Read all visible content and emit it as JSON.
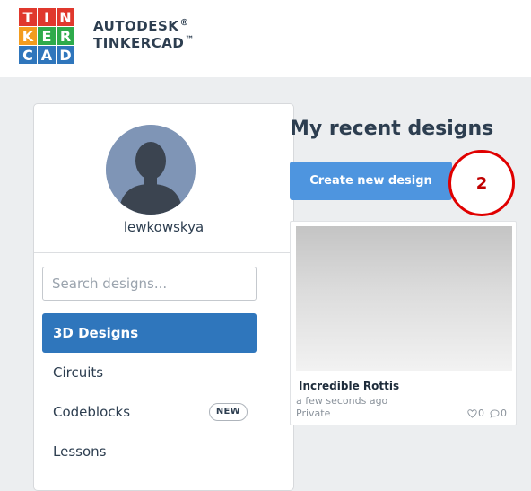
{
  "logo": {
    "letters": [
      "T",
      "I",
      "N",
      "K",
      "E",
      "R",
      "C",
      "A",
      "D"
    ],
    "colors": [
      "#e0382d",
      "#e0382d",
      "#e0382d",
      "#f39c1e",
      "#2eab4b",
      "#2eab4b",
      "#2f76bc",
      "#2f76bc",
      "#2f76bc"
    ],
    "brand_line1": "AUTODESK",
    "brand_mark1": "®",
    "brand_line2": "TINKERCAD",
    "brand_mark2": "™"
  },
  "sidebar": {
    "avatar_icon": "user-silhouette",
    "username": "lewkowskya",
    "search": {
      "placeholder": "Search designs...",
      "value": ""
    },
    "items": [
      {
        "label": "3D Designs",
        "active": true
      },
      {
        "label": "Circuits"
      },
      {
        "label": "Codeblocks",
        "badge": "NEW"
      },
      {
        "label": "Lessons"
      }
    ]
  },
  "main": {
    "title": "My recent designs",
    "create_button": "Create new design",
    "annotation_number": "2",
    "design": {
      "name": "Incredible Rottis",
      "time": "a few seconds ago",
      "visibility": "Private",
      "likes": "0",
      "comments": "0"
    }
  },
  "colors": {
    "accent_blue": "#2f76bc",
    "button_blue": "#4e95df",
    "annotation_red": "#e00000"
  }
}
